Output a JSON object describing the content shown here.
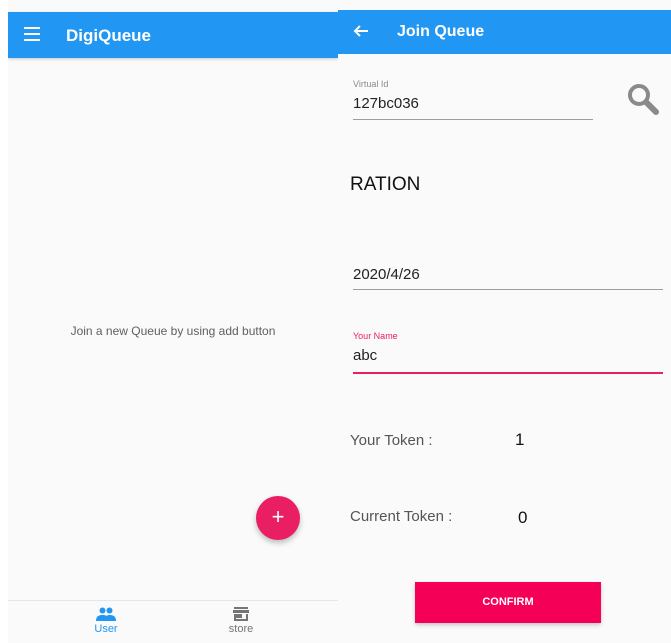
{
  "left_screen": {
    "app_bar": {
      "title": "DigiQueue",
      "menu_icon": "menu-icon",
      "color": "#2196f3"
    },
    "empty_message": "Join a new Queue by using add button",
    "fab": {
      "label": "+",
      "color": "#e91e63"
    },
    "bottom_nav": {
      "items": [
        {
          "label": "User",
          "icon": "people-icon",
          "active": true
        },
        {
          "label": "store",
          "icon": "store-icon",
          "active": false
        }
      ]
    }
  },
  "right_screen": {
    "app_bar": {
      "title": "Join Queue",
      "back_icon": "arrow-back-icon"
    },
    "virtual_id": {
      "label": "Virtual Id",
      "value": "127bc036"
    },
    "search_icon": "search-icon",
    "queue_name": "RATION",
    "date": {
      "value": "2020/4/26"
    },
    "your_name": {
      "label": "Your Name",
      "value": "abc"
    },
    "your_token": {
      "label": "Your Token :",
      "value": "1"
    },
    "current_token": {
      "label": "Current Token :",
      "value": "0"
    },
    "confirm_button": {
      "label": "CONFIRM",
      "color": "#f50057"
    }
  }
}
